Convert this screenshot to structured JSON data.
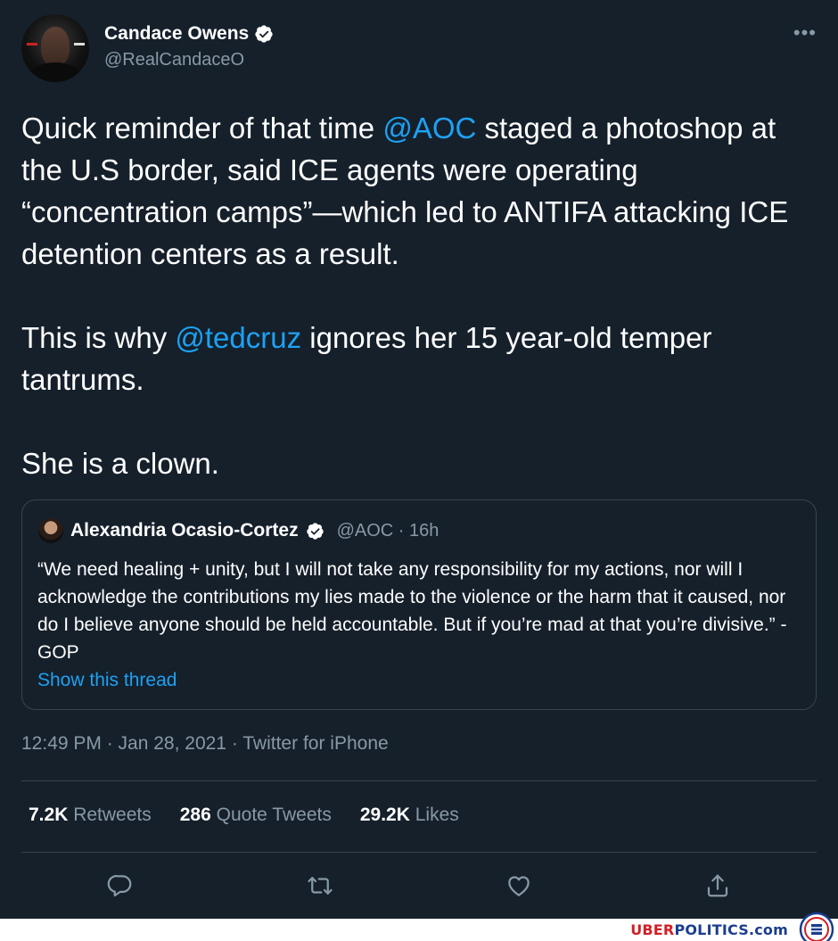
{
  "author": {
    "display_name": "Candace Owens",
    "handle": "@RealCandaceO"
  },
  "menu_icon": "more-horizontal-icon",
  "body": {
    "p1": [
      {
        "text": "Quick reminder of that time ",
        "mention": false
      },
      {
        "text": "@AOC",
        "mention": true
      },
      {
        "text": " staged a photoshop at the U.S border, said ICE agents were operating “concentration camps”—which led to ANTIFA attacking ICE detention centers as a result.",
        "mention": false
      }
    ],
    "p2": [
      {
        "text": "This is why ",
        "mention": false
      },
      {
        "text": "@tedcruz",
        "mention": true
      },
      {
        "text": " ignores her 15 year-old temper tantrums.",
        "mention": false
      }
    ],
    "p3": "She is a clown."
  },
  "quoted_tweet": {
    "display_name": "Alexandria Ocasio-Cortez",
    "handle_time": "@AOC · 16h",
    "text": "“We need healing + unity, but I will not take any responsibility for my actions, nor will I acknowledge the contributions my lies made to the violence or the harm that it caused, nor do I believe anyone should be held accountable. But if you’re mad at that you’re divisive.” - GOP",
    "show_thread": "Show this thread"
  },
  "timestamp": "12:49 PM · Jan 28, 2021 · Twitter for iPhone",
  "stats": {
    "retweets": {
      "num": "7.2K",
      "label": "Retweets"
    },
    "quotes": {
      "num": "286",
      "label": "Quote Tweets"
    },
    "likes": {
      "num": "29.2K",
      "label": "Likes"
    }
  },
  "actions": [
    "reply-icon",
    "retweet-icon",
    "like-icon",
    "share-icon"
  ],
  "watermark": {
    "uber": "UBER",
    "politics": "POLITICS.com"
  },
  "colors": {
    "background": "#15202b",
    "accent": "#1da1f2",
    "secondary_text": "#8899a6",
    "border": "#38444d"
  }
}
